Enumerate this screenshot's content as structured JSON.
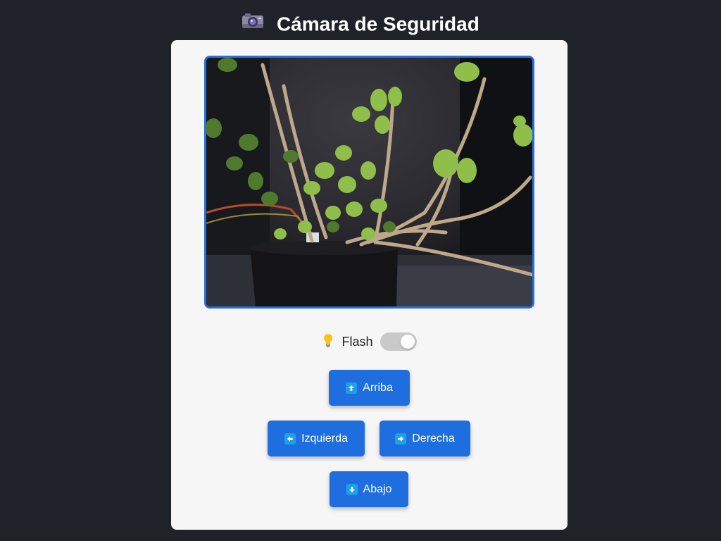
{
  "header": {
    "icon": "camera-icon",
    "title": "Cámara de Seguridad"
  },
  "stream": {
    "icon": "camera-feed-image"
  },
  "flash": {
    "icon": "lightbulb-icon",
    "label": "Flash",
    "enabled": false
  },
  "controls": {
    "up_label": "Arriba",
    "left_label": "Izquierda",
    "right_label": "Derecha",
    "down_label": "Abajo"
  },
  "colors": {
    "background": "#1f2228",
    "card": "#f6f6f6",
    "accent": "#1f6ee0",
    "stream_border": "#2a6fd9",
    "arrow_badge": "#1ea0e8"
  }
}
